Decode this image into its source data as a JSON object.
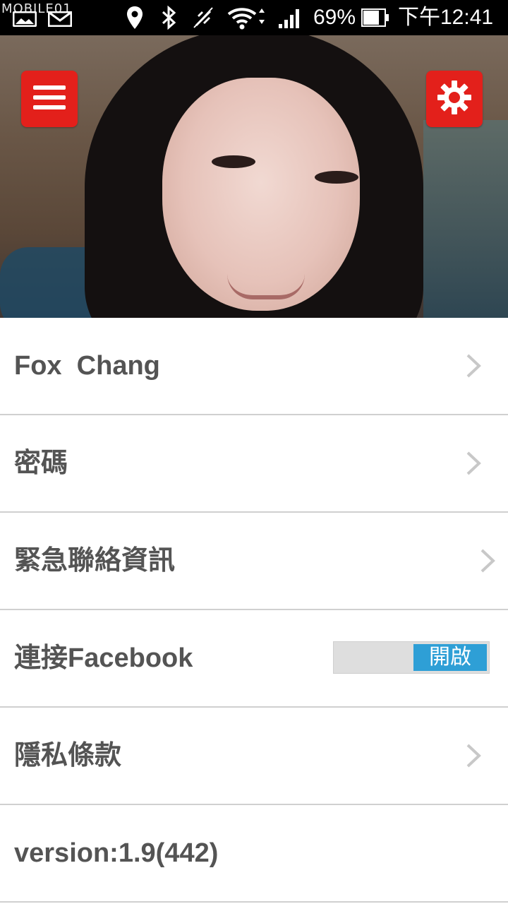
{
  "status_bar": {
    "watermark": "MOBILE01",
    "battery": "69%",
    "time": "下午12:41",
    "icons": [
      "photo-icon",
      "gmail-icon",
      "location-icon",
      "bluetooth-icon",
      "vibrate-off-icon",
      "wifi-icon",
      "signal-icon",
      "battery-icon"
    ]
  },
  "header": {
    "menu_icon": "hamburger-menu-icon",
    "settings_icon": "gear-icon",
    "accent_color": "#e3201b"
  },
  "settings": {
    "items": [
      {
        "label": "Fox  Chang",
        "type": "link"
      },
      {
        "label": "密碼",
        "type": "link"
      },
      {
        "label": "緊急聯絡資訊",
        "type": "link"
      },
      {
        "label": "連接Facebook",
        "type": "toggle",
        "toggle_label": "開啟",
        "toggle_on": true
      },
      {
        "label": "隱私條款",
        "type": "link"
      },
      {
        "label": "version:1.9(442)",
        "type": "text"
      }
    ]
  },
  "colors": {
    "toggle_on": "#2e9fd6",
    "text": "#545454",
    "divider": "#d0d0d0"
  }
}
